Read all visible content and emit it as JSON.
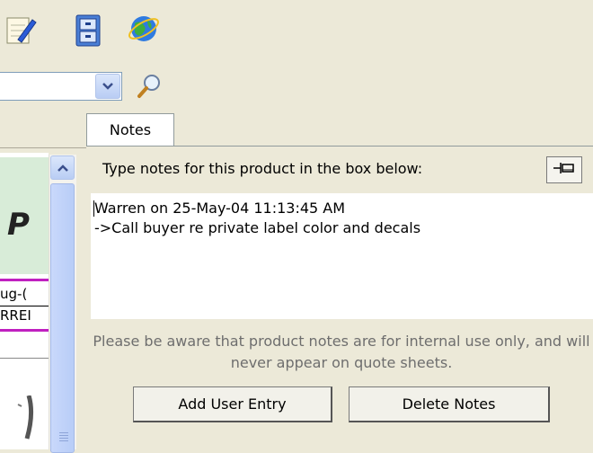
{
  "toolbar": {
    "icons": [
      "notepad-icon",
      "file-cabinet-icon",
      "internet-globe-icon"
    ]
  },
  "search": {
    "icons": [
      "chevron-down-icon",
      "magnifier-icon"
    ]
  },
  "document": {
    "heading_fragment": "P",
    "line1_fragment": "ug-(",
    "line2_fragment": "RREI"
  },
  "notes_tab": {
    "label": "Notes",
    "prompt": "Type notes for this product in the box below:",
    "pin_icon": "pushpin-icon",
    "content": "Warren on 25-May-04 11:13:45 AM\n->Call buyer re private label color and decals",
    "warning": "Please be aware that product notes are for internal use only, and will never appear on quote sheets.",
    "buttons": {
      "add_user_entry": "Add User Entry",
      "delete_notes": "Delete Notes"
    }
  },
  "colors": {
    "window_bg": "#ece9d8",
    "accent_blue": "#b9cdf4",
    "magenta_rule": "#c020c0",
    "hint_gray": "#6e6e6e"
  }
}
